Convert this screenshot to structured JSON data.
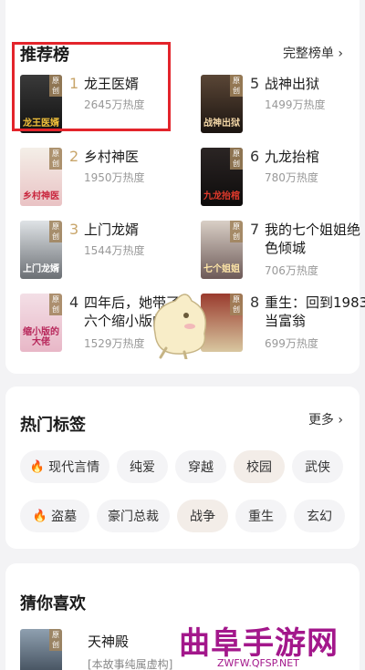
{
  "ranking": {
    "title": "推荐榜",
    "more_label": "完整榜单",
    "items": [
      {
        "rank": "1",
        "title": "龙王医婿",
        "heat": "2645万热度",
        "cover_text": "龙王医婿"
      },
      {
        "rank": "2",
        "title": "乡村神医",
        "heat": "1950万热度",
        "cover_text": "乡村神医"
      },
      {
        "rank": "3",
        "title": "上门龙婿",
        "heat": "1544万热度",
        "cover_text": "上门龙婿"
      },
      {
        "rank": "4",
        "title": "四年后，她带了六个缩小版的...",
        "heat": "1529万热度",
        "cover_text": "缩小版的大佬"
      },
      {
        "rank": "5",
        "title": "战神出狱",
        "heat": "1499万热度",
        "cover_text": "战神出狱"
      },
      {
        "rank": "6",
        "title": "九龙抬棺",
        "heat": "780万热度",
        "cover_text": "九龙抬棺"
      },
      {
        "rank": "7",
        "title": "我的七个姐姐绝色倾城",
        "heat": "706万热度",
        "cover_text": "七个姐姐"
      },
      {
        "rank": "8",
        "title": "重生：回到1983当富翁",
        "heat": "699万热度",
        "cover_text": ""
      }
    ]
  },
  "tags": {
    "title": "热门标签",
    "more_label": "更多",
    "items": [
      "现代言情",
      "纯爱",
      "穿越",
      "校园",
      "武侠",
      "盗墓",
      "豪门总裁",
      "战争",
      "重生",
      "玄幻"
    ]
  },
  "guess": {
    "title": "猜你喜欢",
    "items": [
      {
        "title": "天神殿",
        "snippet": "[本故事纯属虚构]",
        "cover_text": "原创"
      }
    ]
  },
  "cover_tag": "原创",
  "watermark": {
    "main": "曲阜手游网",
    "url": "ZWFW.QFSP.NET"
  },
  "colors": {
    "highlight": "#e3242b",
    "rank_top": "#c8a56a",
    "fire": "#f07b3f",
    "watermark": "#a3178b"
  }
}
